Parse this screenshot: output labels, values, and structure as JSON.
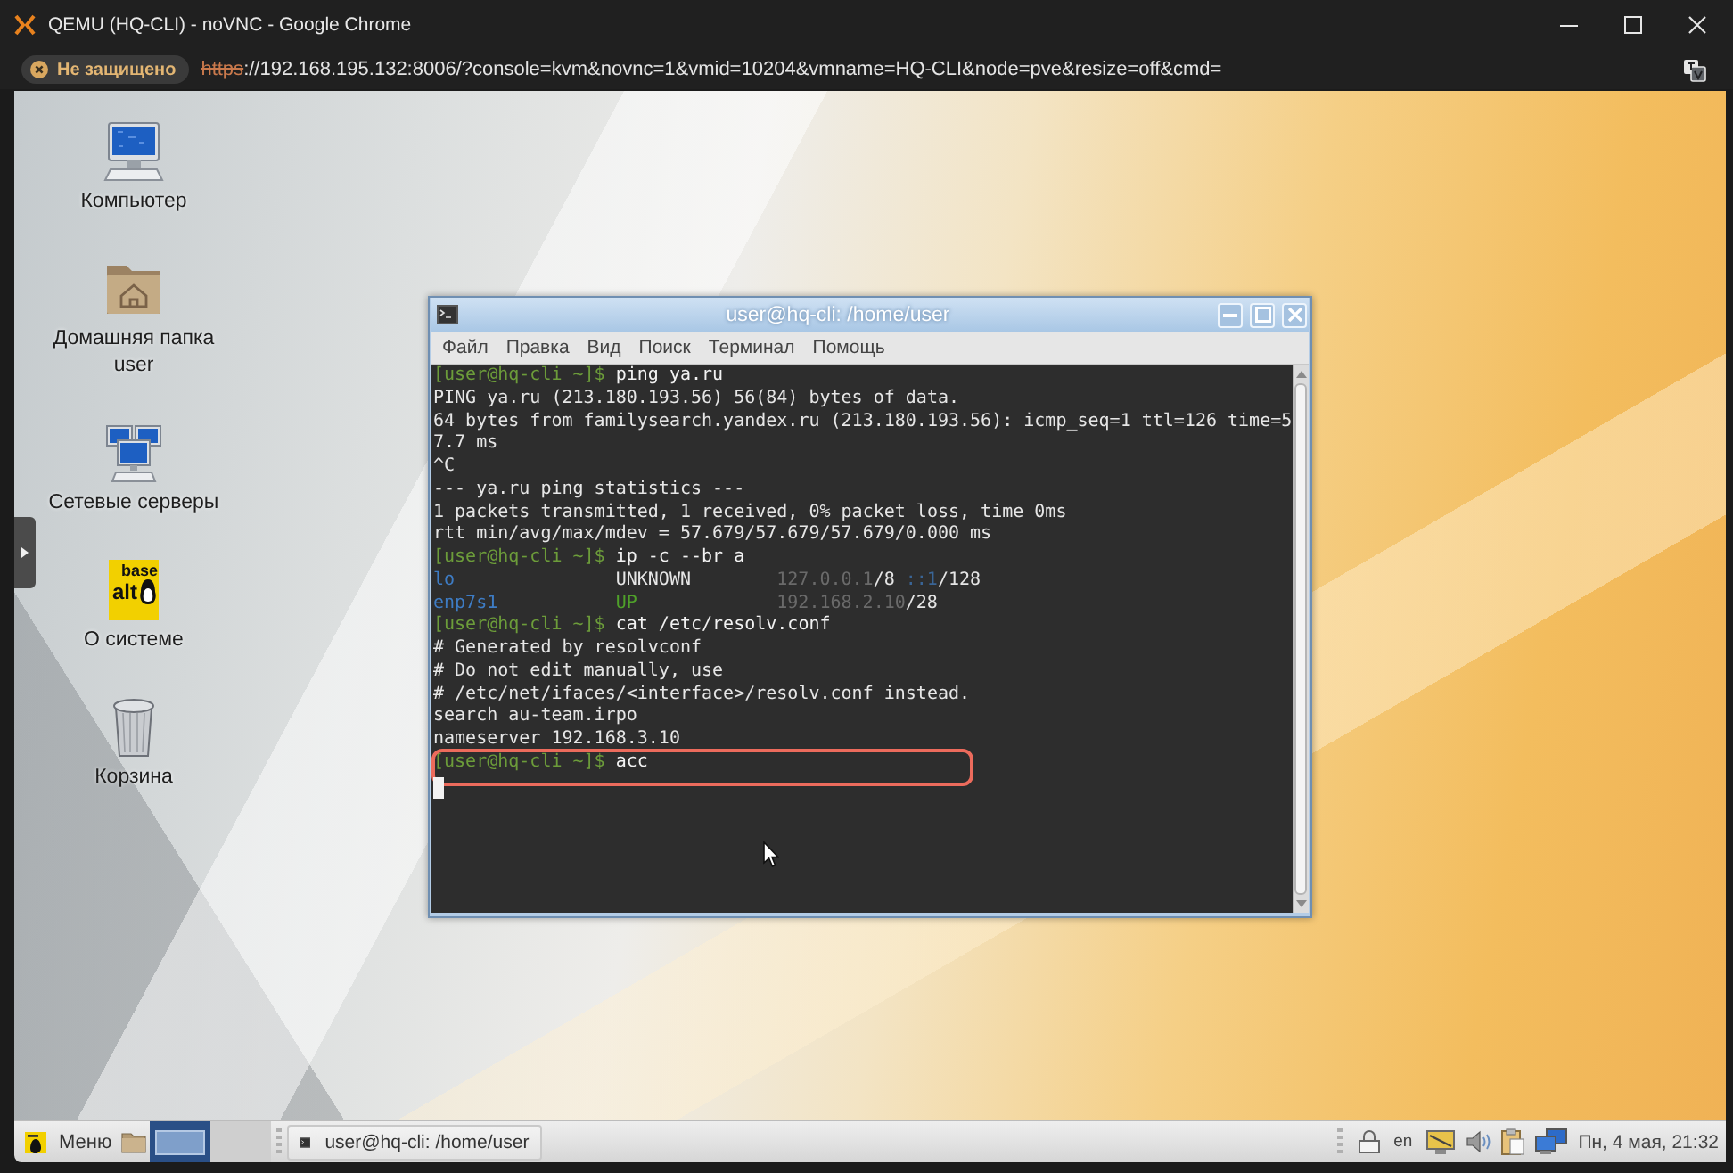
{
  "browser": {
    "title": "QEMU (HQ-CLI) - noVNC - Google Chrome",
    "security_label": "Не защищено",
    "url_scheme": "https",
    "url_rest": "://192.168.195.132:8006/?console=kvm&novnc=1&vmid=10204&vmname=HQ-CLI&node=pve&resize=off&cmd="
  },
  "desktop_icons": [
    {
      "kind": "computer",
      "label": "Компьютер"
    },
    {
      "kind": "home_folder",
      "label": "Домашняя папка user"
    },
    {
      "kind": "network",
      "label": "Сетевые серверы"
    },
    {
      "kind": "about",
      "label": "О системе",
      "logo_lines": [
        "base",
        "alt"
      ]
    },
    {
      "kind": "trash",
      "label": "Корзина"
    }
  ],
  "terminal": {
    "title": "user@hq-cli: /home/user",
    "menu": [
      "Файл",
      "Правка",
      "Вид",
      "Поиск",
      "Терминал",
      "Помощь"
    ],
    "lines": [
      {
        "kind": "command",
        "prompt": "[user@hq-cli ~]$",
        "command": "ping ya.ru",
        "highlighted": false
      },
      {
        "kind": "output",
        "text": "PING ya.ru (213.180.193.56) 56(84) bytes of data.",
        "highlighted": false
      },
      {
        "kind": "output",
        "text": "64 bytes from familysearch.yandex.ru (213.180.193.56): icmp_seq=1 ttl=126 time=5",
        "highlighted": false
      },
      {
        "kind": "output",
        "text": "7.7 ms",
        "highlighted": false
      },
      {
        "kind": "output",
        "text": "^C",
        "highlighted": false
      },
      {
        "kind": "output",
        "text": "--- ya.ru ping statistics ---",
        "highlighted": false
      },
      {
        "kind": "output",
        "text": "1 packets transmitted, 1 received, 0% packet loss, time 0ms",
        "highlighted": false
      },
      {
        "kind": "output",
        "text": "rtt min/avg/max/mdev = 57.679/57.679/57.679/0.000 ms",
        "highlighted": false
      },
      {
        "kind": "command",
        "prompt": "[user@hq-cli ~]$",
        "command": "ip -c --br a",
        "highlighted": false
      },
      {
        "kind": "interface",
        "name": "lo",
        "state": "UNKNOWN",
        "state_up": false,
        "addresses": [
          {
            "kind": "ipv4",
            "address": "127.0.0.1",
            "prefix": "/8"
          },
          {
            "kind": "ipv6",
            "address": "::1",
            "prefix": "/128"
          }
        ],
        "highlighted": false
      },
      {
        "kind": "interface",
        "name": "enp7s1",
        "state": "UP",
        "state_up": true,
        "addresses": [
          {
            "kind": "ipv4",
            "address": "192.168.2.10",
            "prefix": "/28"
          }
        ],
        "highlighted": false
      },
      {
        "kind": "command",
        "prompt": "[user@hq-cli ~]$",
        "command": "cat /etc/resolv.conf",
        "highlighted": false
      },
      {
        "kind": "output",
        "text": "# Generated by resolvconf",
        "highlighted": false
      },
      {
        "kind": "output",
        "text": "# Do not edit manually, use",
        "highlighted": false
      },
      {
        "kind": "output",
        "text": "# /etc/net/ifaces/<interface>/resolv.conf instead.",
        "highlighted": false
      },
      {
        "kind": "output",
        "text": "search au-team.irpo",
        "highlighted": false
      },
      {
        "kind": "output",
        "text": "nameserver 192.168.3.10",
        "highlighted": false
      },
      {
        "kind": "command",
        "prompt": "[user@hq-cli ~]$",
        "command": "acc",
        "highlighted": true
      },
      {
        "kind": "cursor",
        "highlighted": false
      }
    ]
  },
  "taskbar": {
    "menu_label": "Меню",
    "workspaces": [
      {
        "selected": true
      },
      {
        "selected": false
      }
    ],
    "tasks": [
      {
        "label": "user@hq-cli: /home/user"
      }
    ],
    "keyboard_layout": "en",
    "clock": "Пн, 4 мая, 21:32"
  }
}
